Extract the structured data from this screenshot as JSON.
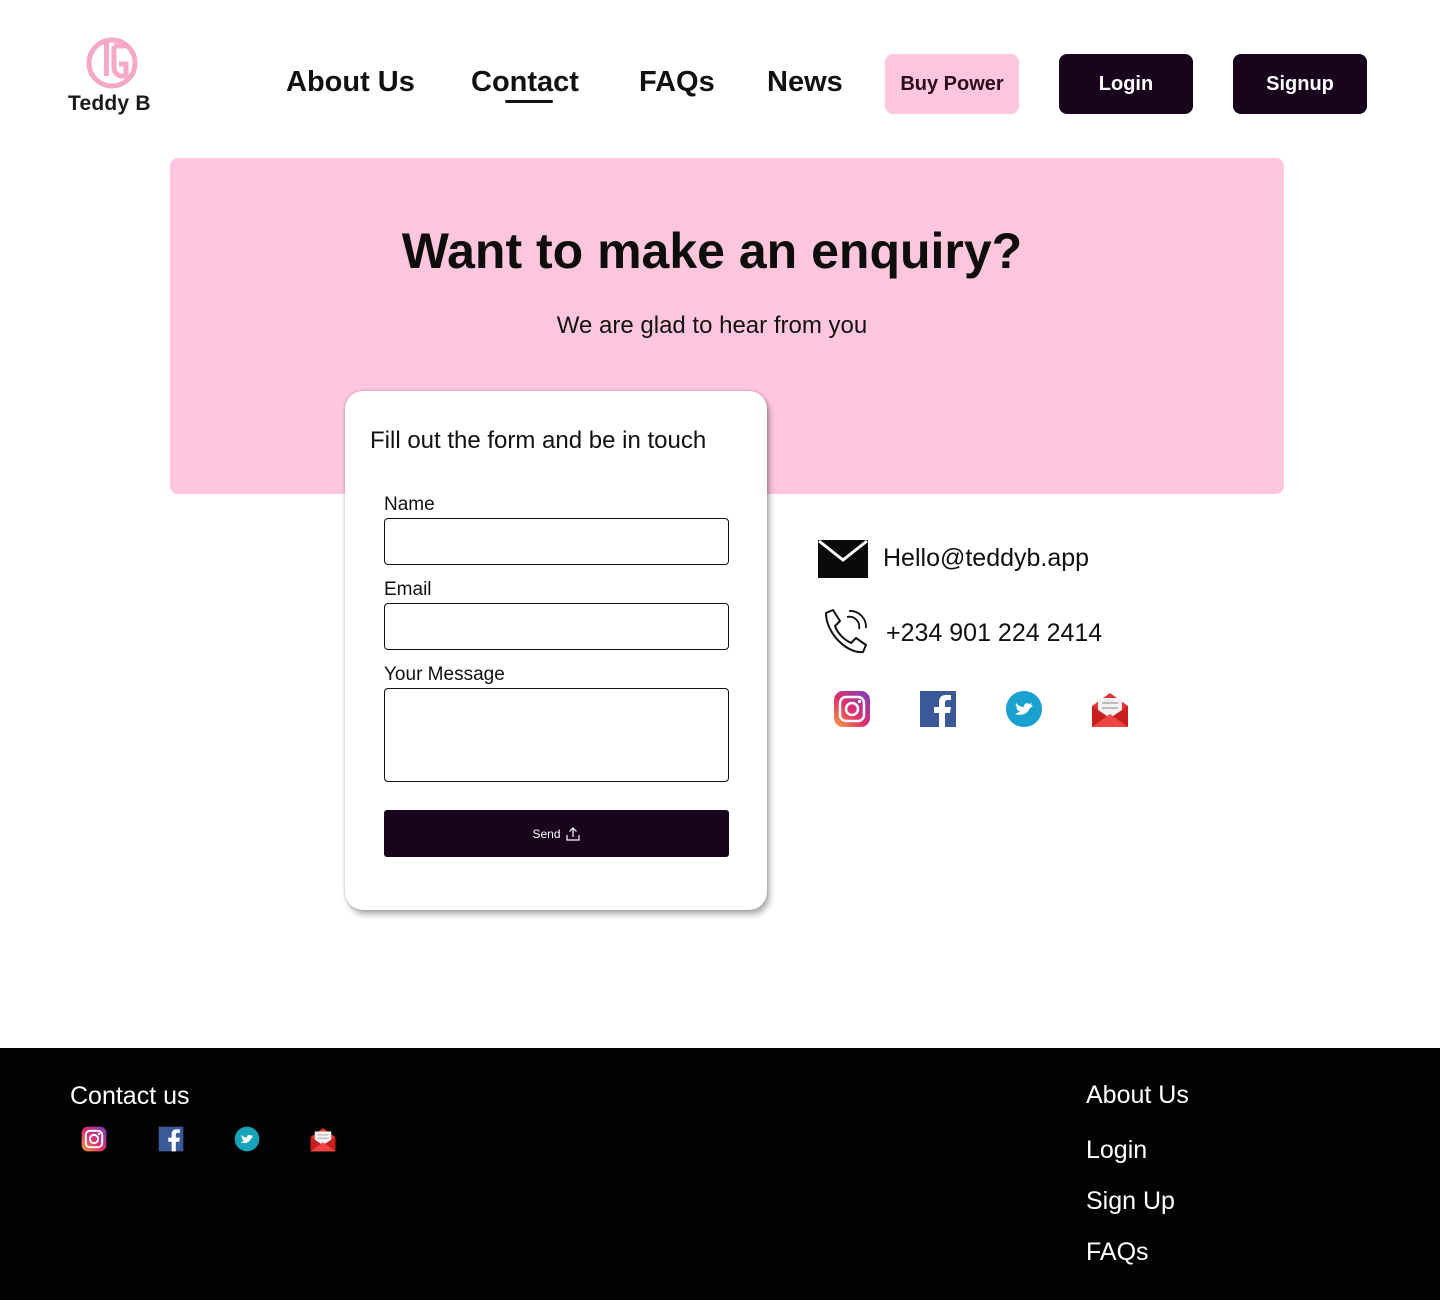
{
  "brand": {
    "name": "Teddy B",
    "color": "#ffc6dd",
    "dark": "#18041c"
  },
  "nav": {
    "links": [
      "About Us",
      "Contact",
      "FAQs",
      "News"
    ],
    "active": "Contact",
    "buy_label": "Buy Power",
    "login_label": "Login",
    "signup_label": "Signup"
  },
  "hero": {
    "title": "Want to make an enquiry?",
    "subtitle": "We are glad to hear from you"
  },
  "form": {
    "title": "Fill out the form and be in touch",
    "name_label": "Name",
    "name_value": "",
    "email_label": "Email",
    "email_value": "",
    "message_label": "Your Message",
    "message_value": "",
    "send_label": "Send"
  },
  "contact": {
    "email": "Hello@teddyb.app",
    "phone": "+234 901 224 2414",
    "socials": [
      "instagram-icon",
      "facebook-icon",
      "twitter-icon",
      "mail-icon"
    ]
  },
  "footer": {
    "title": "Contact us",
    "links": [
      "About Us",
      "Login",
      "Sign Up",
      "FAQs"
    ]
  }
}
